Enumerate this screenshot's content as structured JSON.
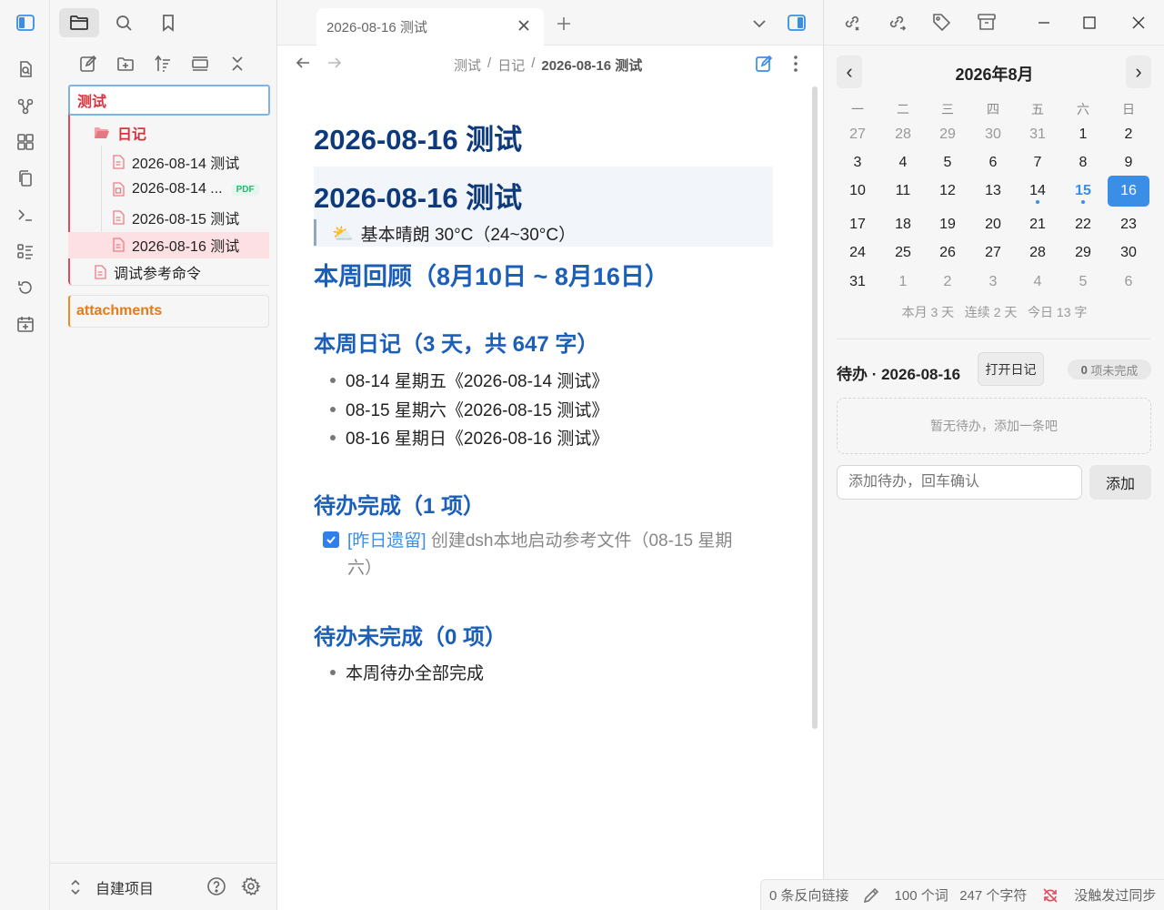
{
  "left_sidebar": {
    "file_tree": {
      "root_folder": "测试",
      "subfolder": "日记",
      "files": [
        {
          "name": "2026-08-14 测试"
        },
        {
          "name": "2026-08-14 ...",
          "badge": "PDF"
        },
        {
          "name": "2026-08-15 测试"
        },
        {
          "name": "2026-08-16 测试"
        }
      ],
      "root_file": "调试参考命令",
      "second_root": "attachments"
    },
    "footer": {
      "vault_name": "自建项目"
    }
  },
  "tabs": [
    {
      "title": "2026-08-16 测试"
    }
  ],
  "breadcrumb": [
    "测试",
    "/",
    "日记",
    "/",
    "2026-08-16 测试"
  ],
  "document": {
    "title": "2026-08-16 测试",
    "callout": {
      "heading": "2026-08-16 测试",
      "weather_icon": "⛅",
      "weather_text": "基本晴朗 30°C（24~30°C）"
    },
    "week_review_heading": "本周回顾（8月10日 ~ 8月16日）",
    "diary_heading": "本周日记（3 天，共 647 字）",
    "diary_items": [
      "08-14 星期五《2026-08-14 测试》",
      "08-15 星期六《2026-08-15 测试》",
      "08-16 星期日《2026-08-16 测试》"
    ],
    "done_heading": "待办完成（1 项）",
    "done_item": {
      "tag": "[昨日遗留]",
      "text_line1": "创建dsh本地启动参考文件（08-15 星期",
      "text_line2": "六）",
      "checked": true
    },
    "undone_heading": "待办未完成（0 项）",
    "undone_items": [
      "本周待办全部完成"
    ]
  },
  "calendar": {
    "month_label": "2026年8月",
    "prev_label": "‹",
    "next_label": "›",
    "weekdays": [
      "一",
      "二",
      "三",
      "四",
      "五",
      "六",
      "日"
    ],
    "weeks": [
      [
        "27",
        "28",
        "29",
        "30",
        "31",
        "1",
        "2"
      ],
      [
        "3",
        "4",
        "5",
        "6",
        "7",
        "8",
        "9"
      ],
      [
        "10",
        "11",
        "12",
        "13",
        "14",
        "15",
        "16"
      ],
      [
        "17",
        "18",
        "19",
        "20",
        "21",
        "22",
        "23"
      ],
      [
        "24",
        "25",
        "26",
        "27",
        "28",
        "29",
        "30"
      ],
      [
        "31",
        "1",
        "2",
        "3",
        "4",
        "5",
        "6"
      ]
    ],
    "selected_day": "16",
    "today": "15",
    "days_with_notes": [
      "14",
      "15"
    ],
    "stats": "本月 3 天   连续 2 天   今日 13 字",
    "accent_color": "#3a8ee6"
  },
  "todo": {
    "title": "待办 · 2026-08-16",
    "open_diary_label": "打开日记",
    "count_badge": "0 项未完成",
    "empty_text": "暂无待办，添加一条吧",
    "input_placeholder": "添加待办，回车确认",
    "add_label": "添加"
  },
  "status_bar": {
    "backlinks": "0 条反向链接",
    "counts": "100 个词   247 个字符",
    "sync": "没触发过同步"
  }
}
